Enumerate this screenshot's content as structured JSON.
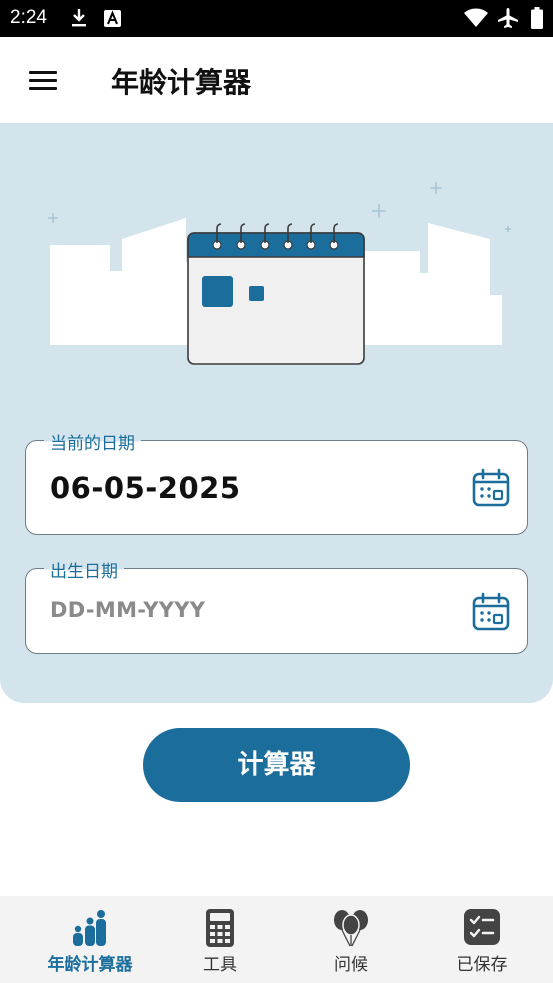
{
  "status_bar": {
    "time": "2:24",
    "left_icons": [
      "download-icon",
      "font-a-icon"
    ],
    "right_icons": [
      "wifi-icon",
      "airplane-icon",
      "battery-icon"
    ]
  },
  "app_bar": {
    "menu_icon": "menu-icon",
    "title": "年龄计算器"
  },
  "form": {
    "current_date": {
      "label": "当前的日期",
      "value": "06-05-2025",
      "icon": "calendar-icon"
    },
    "birth_date": {
      "label": "出生日期",
      "placeholder": "DD-MM-YYYY",
      "value": "",
      "icon": "calendar-icon"
    }
  },
  "calculate_button": {
    "label": "计算器"
  },
  "bottom_nav": {
    "items": [
      {
        "label": "年龄计算器",
        "icon": "family-icon",
        "active": true
      },
      {
        "label": "工具",
        "icon": "calculator-icon",
        "active": false
      },
      {
        "label": "问候",
        "icon": "balloons-icon",
        "active": false
      },
      {
        "label": "已保存",
        "icon": "checklist-icon",
        "active": false
      }
    ]
  },
  "colors": {
    "accent": "#1b6e9c",
    "hero_background": "#d3e4ec",
    "status_bar": "#000000",
    "nav_background": "#f3f3f3"
  }
}
